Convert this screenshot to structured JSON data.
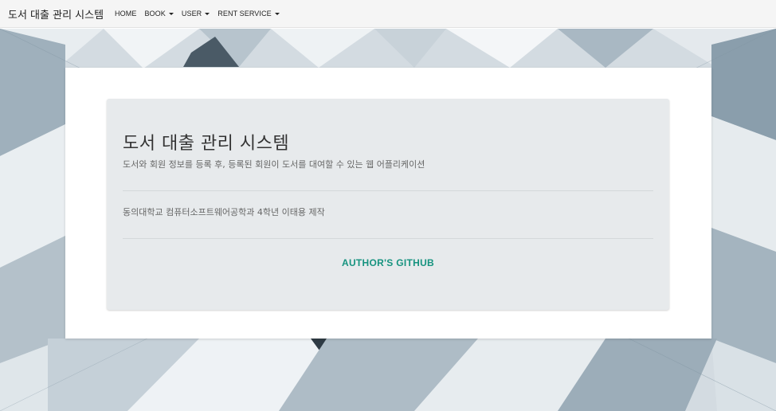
{
  "navbar": {
    "brand": "도서 대출 관리 시스템",
    "items": [
      {
        "label": "HOME",
        "dropdown": false
      },
      {
        "label": "BOOK",
        "dropdown": true
      },
      {
        "label": "USER",
        "dropdown": true
      },
      {
        "label": "RENT SERVICE",
        "dropdown": true
      }
    ]
  },
  "jumbotron": {
    "title": "도서 대출 관리 시스템",
    "lead": "도서와 회원 정보를 등록 후, 등록된 회원이 도서를 대여할 수 있는 웹 어플리케이션",
    "credit": "동의대학교 컴퓨터소프트웨어공학과 4학년 이태용 제작",
    "link_label": "AUTHOR'S GITHUB"
  },
  "colors": {
    "accent": "#16937f",
    "navbar_bg": "#f5f5f5",
    "jumbotron_bg": "#e7eaec"
  }
}
